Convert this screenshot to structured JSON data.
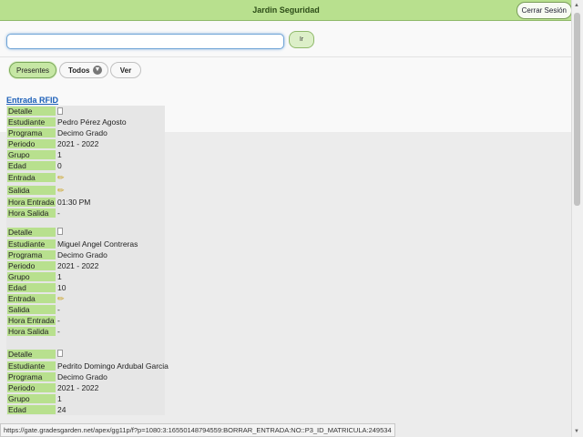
{
  "header": {
    "title": "Jardin Seguridad",
    "logout_label": "Cerrar Sesión"
  },
  "search": {
    "value": "",
    "go_label": "Ir"
  },
  "filters": {
    "presentes_label": "Presentes",
    "todos_label": "Todos",
    "ver_label": "Ver"
  },
  "report": {
    "link_label": "Entrada RFID"
  },
  "labels": {
    "detalle": "Detalle",
    "estudiante": "Estudiante",
    "programa": "Programa",
    "periodo": "Periodo",
    "grupo": "Grupo",
    "edad": "Edad",
    "entrada": "Entrada",
    "salida": "Salida",
    "hora_entrada": "Hora Entrada",
    "hora_salida": "Hora Salida"
  },
  "records": [
    {
      "estudiante": "Pedro Pérez Agosto",
      "programa": "Decimo Grado",
      "periodo": "2021 - 2022",
      "grupo": "1",
      "edad": "0",
      "entrada_icon": "key-icon",
      "salida_icon": "key-icon",
      "hora_entrada": "01:30 PM",
      "hora_salida": "-"
    },
    {
      "estudiante": "Miguel Angel Contreras",
      "programa": "Decimo Grado",
      "periodo": "2021 - 2022",
      "grupo": "1",
      "edad": "10",
      "entrada_icon": "key-icon",
      "salida": "-",
      "hora_entrada": "-",
      "hora_salida": "-"
    },
    {
      "estudiante": "Pedrito Domingo Ardubal Garcia",
      "programa": "Decimo Grado",
      "periodo": "2021 - 2022",
      "grupo": "1",
      "edad": "24"
    }
  ],
  "status": {
    "url": "https://gate.gradesgarden.net/apex/gg11p/f?p=1080:3:16550148794559:BORRAR_ENTRADA:NO::P3_ID_MATRICULA:249534"
  }
}
